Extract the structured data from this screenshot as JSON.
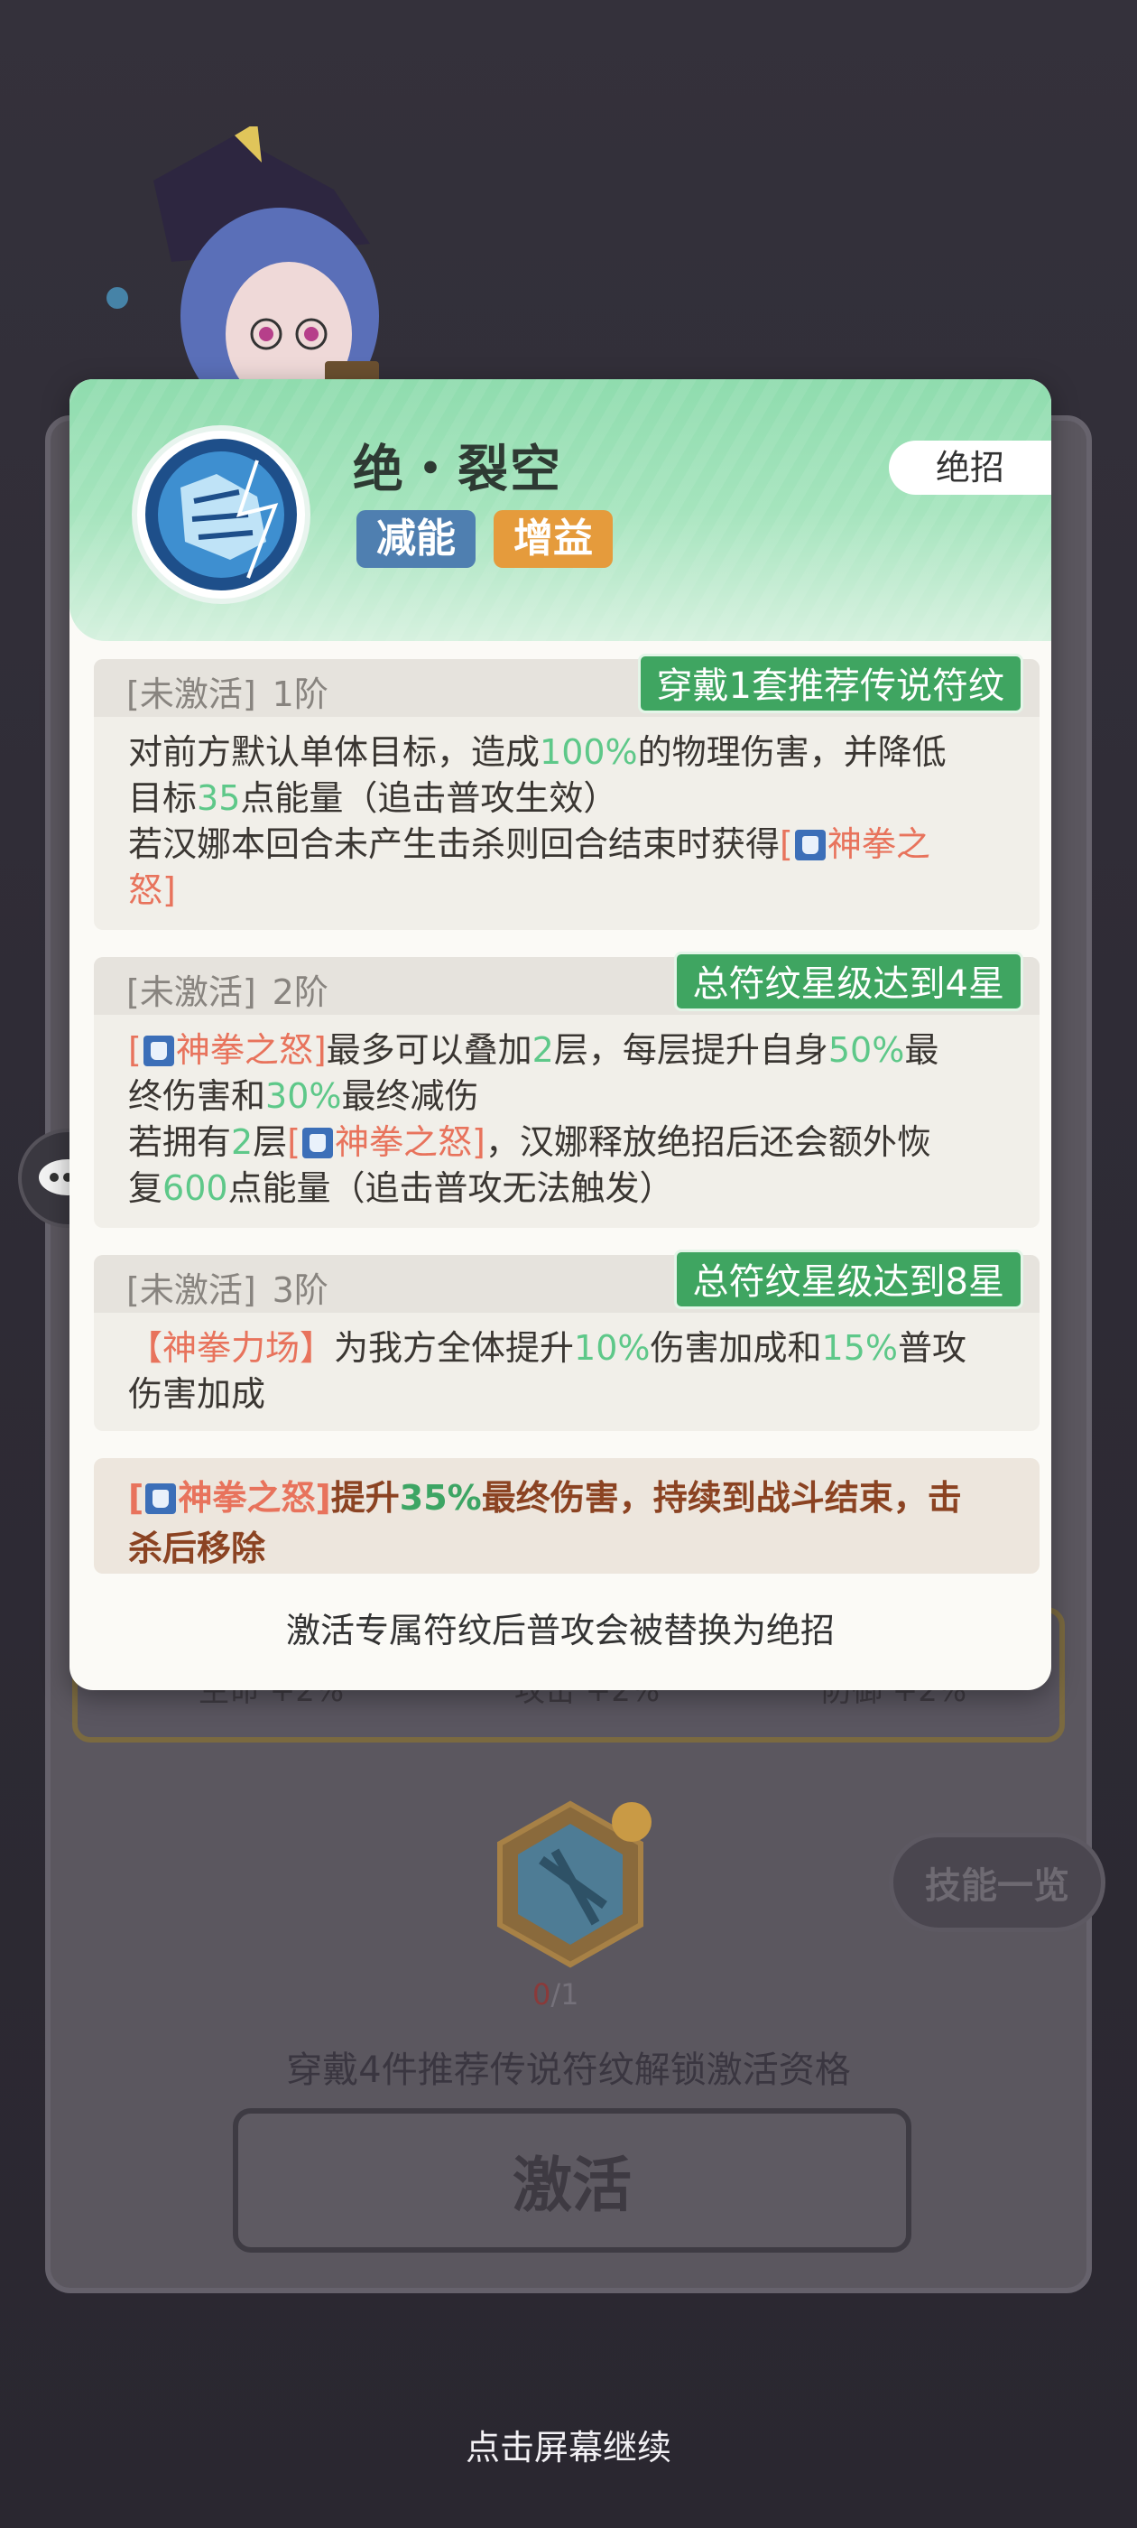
{
  "background": {
    "stats": [
      {
        "label": "生命 +2%"
      },
      {
        "label": "攻击 +2%"
      },
      {
        "label": "防御 +2%"
      }
    ],
    "skill_list_label": "技能一览",
    "rune_count_current": "0",
    "rune_count_total": "/1",
    "unlock_hint": "穿戴4件推荐传说符纹解锁激活资格",
    "activate_label": "激活",
    "continue_hint": "点击屏幕继续"
  },
  "card": {
    "skill_name": "绝・裂空",
    "tags": [
      "减能",
      "增益"
    ],
    "type_badge": "绝招",
    "sections": [
      {
        "status": "[未激活]",
        "tier": "1阶",
        "requirement": "穿戴1套推荐传说符纹",
        "line1_a": "对前方默认单体目标，造成",
        "line1_b": "100%",
        "line1_c": "的物理伤害，并降低",
        "line2_a": "目标",
        "line2_b": "35",
        "line2_c": "点能量（追击普攻生效）",
        "line3_a": "若汉娜本回合未产生击杀则回合结束时获得",
        "line3_b": "[",
        "line3_c": "神拳之",
        "line4": "怒]"
      },
      {
        "status": "[未激活]",
        "tier": "2阶",
        "requirement": "总符纹星级达到4星",
        "l1_a": "[",
        "l1_b": "神拳之怒]",
        "l1_c": "最多可以叠加",
        "l1_d": "2",
        "l1_e": "层，每层提升自身",
        "l1_f": "50%",
        "l1_g": "最",
        "l2_a": "终伤害和",
        "l2_b": "30%",
        "l2_c": "最终减伤",
        "l3_a": "若拥有",
        "l3_b": "2",
        "l3_c": "层",
        "l3_d": "[",
        "l3_e": "神拳之怒]",
        "l3_f": "，汉娜释放绝招后还会额外恢",
        "l4_a": "复",
        "l4_b": "600",
        "l4_c": "点能量（追击普攻无法触发）"
      },
      {
        "status": "[未激活]",
        "tier": "3阶",
        "requirement": "总符纹星级达到8星",
        "l1_a": "【神拳力场】",
        "l1_b": "为我方全体提升",
        "l1_c": "10%",
        "l1_d": "伤害加成和",
        "l1_e": "15%",
        "l1_f": "普攻",
        "l2": "伤害加成"
      }
    ],
    "final_note": {
      "a": "[",
      "b": "神拳之怒]",
      "c": "提升",
      "d": "35%",
      "e": "最终伤害，持续到战斗结束，击",
      "f": "杀后移除"
    },
    "footer": "激活专属符纹后普攻会被替换为绝招"
  },
  "colors": {
    "green_text": "#5ec889",
    "red_text": "#e8735c",
    "requirement_bg": "#3fa561",
    "tag_blue": "#4f7fb0",
    "tag_orange": "#e59b3c"
  }
}
